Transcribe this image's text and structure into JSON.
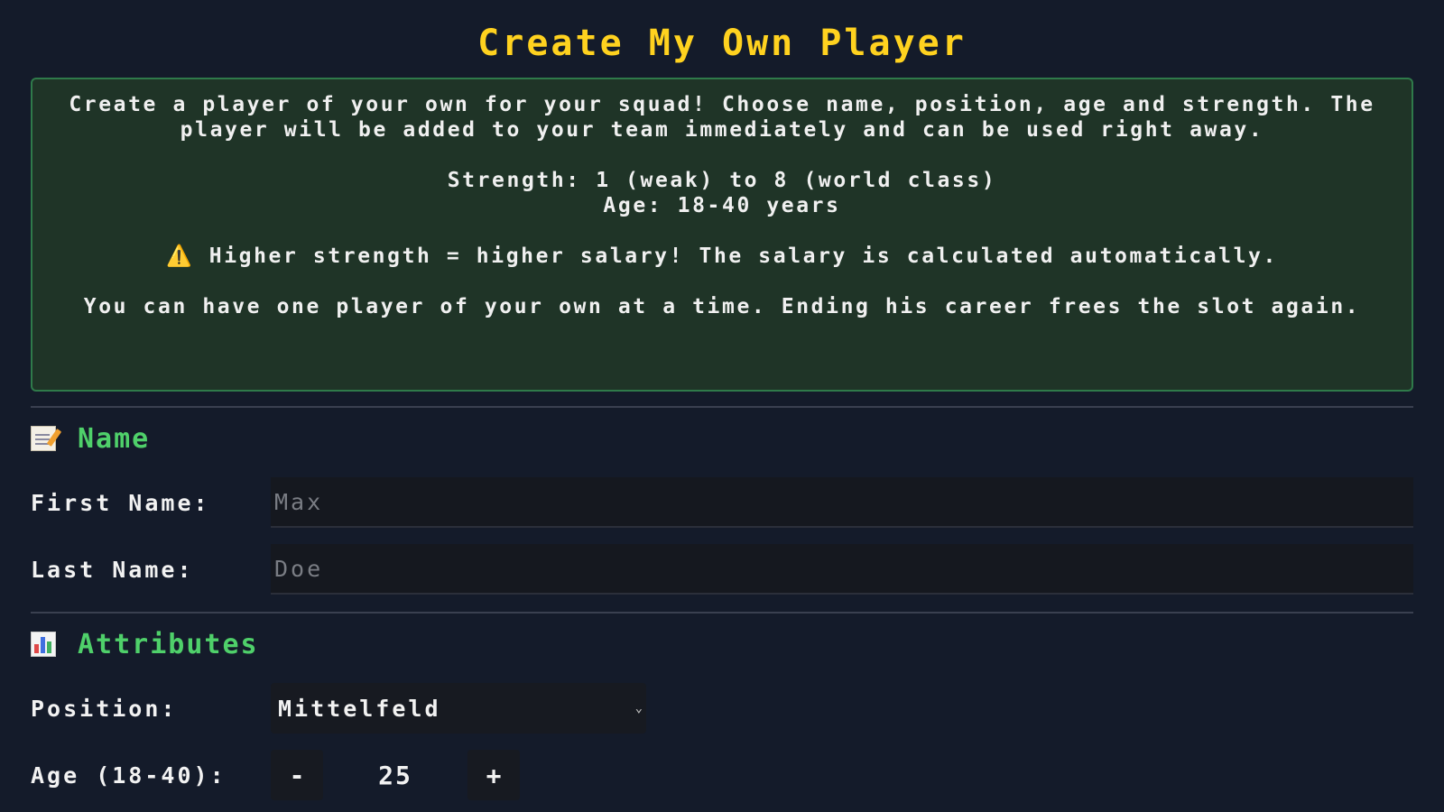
{
  "title": "Create My Own Player",
  "info": {
    "intro": "Create a player of your own for your squad! Choose name, position, age and strength. The player will be added to your team immediately and can be used right away.",
    "strength_range": "Strength: 1 (weak) to 8 (world class)",
    "age_range": "Age: 18-40 years",
    "warning_icon": "⚠️",
    "warning": "Higher strength = higher salary! The salary is calculated automatically.",
    "slot_note": "You can have one player of your own at a time. Ending his career frees the slot again."
  },
  "name_section": {
    "icon": "memo-icon",
    "heading": "Name",
    "first_name_label": "First Name:",
    "first_name_placeholder": "Max",
    "first_name_value": "",
    "last_name_label": "Last Name:",
    "last_name_placeholder": "Doe",
    "last_name_value": ""
  },
  "attributes_section": {
    "icon": "bar-chart-icon",
    "heading": "Attributes",
    "position_label": "Position:",
    "position_value": "Mittelfeld",
    "age_label": "Age (18-40):",
    "age_value": "25",
    "decrement_label": "-",
    "increment_label": "+"
  },
  "colors": {
    "title": "#ffd21f",
    "section_heading": "#4fd06a",
    "info_bg": "#1f3427",
    "info_border": "#2f7a4a",
    "background": "#141b2a"
  }
}
